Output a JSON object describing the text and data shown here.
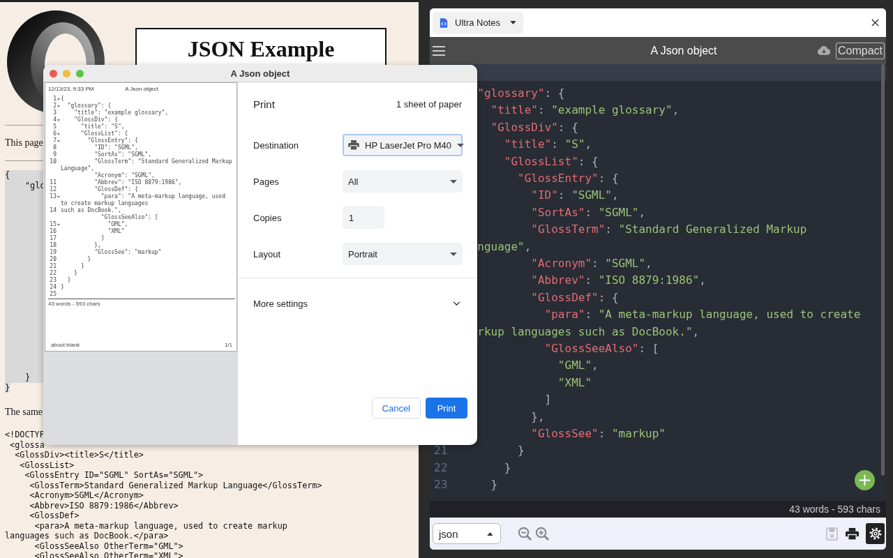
{
  "browser_page": {
    "heading": "JSON Example",
    "intro": "This page",
    "code_top": [
      "{",
      "    \"glo"
    ],
    "code_bottom": [
      "    }",
      "}"
    ],
    "caption": "The same",
    "xml_lines": [
      "<!DOCTYP",
      " <glossa",
      "  <GlossDiv><title>S</title>",
      "   <GlossList>",
      "    <GlossEntry ID=\"SGML\" SortAs=\"SGML\">",
      "     <GlossTerm>Standard Generalized Markup Language</GlossTerm>",
      "     <Acronym>SGML</Acronym>",
      "     <Abbrev>ISO 8879:1986</Abbrev>",
      "     <GlossDef>",
      "      <para>A meta-markup language, used to create markup",
      "languages such as DocBook.</para>",
      "      <GlossSeeAlso OtherTerm=\"GML\">",
      "      <GlossSeeAlso OtherTerm=\"XML\">"
    ]
  },
  "editor": {
    "tab": {
      "label": "Ultra Notes"
    },
    "title": "A Json object",
    "compact_label": "Compact",
    "lines": [
      {
        "current": true
      },
      {
        "current": false,
        "segments": [
          {
            "kind": "key",
            "text": "  \"glossary\""
          },
          {
            "kind": "punct",
            "text": ": {"
          }
        ]
      },
      {
        "current": false,
        "segments": [
          {
            "kind": "key",
            "text": "    \"title\""
          },
          {
            "kind": "punct",
            "text": ": "
          },
          {
            "kind": "string",
            "text": "\"example glossary\""
          },
          {
            "kind": "punct",
            "text": ","
          }
        ]
      },
      {
        "current": false,
        "segments": [
          {
            "kind": "key",
            "text": "    \"GlossDiv\""
          },
          {
            "kind": "punct",
            "text": ": {"
          }
        ]
      },
      {
        "current": false,
        "segments": [
          {
            "kind": "key",
            "text": "      \"title\""
          },
          {
            "kind": "punct",
            "text": ": "
          },
          {
            "kind": "string",
            "text": "\"S\""
          },
          {
            "kind": "punct",
            "text": ","
          }
        ]
      },
      {
        "current": false,
        "segments": [
          {
            "kind": "key",
            "text": "      \"GlossList\""
          },
          {
            "kind": "punct",
            "text": ": {"
          }
        ]
      },
      {
        "current": false,
        "segments": [
          {
            "kind": "key",
            "text": "        \"GlossEntry\""
          },
          {
            "kind": "punct",
            "text": ": {"
          }
        ]
      },
      {
        "current": false,
        "segments": [
          {
            "kind": "key",
            "text": "          \"ID\""
          },
          {
            "kind": "punct",
            "text": ": "
          },
          {
            "kind": "string",
            "text": "\"SGML\""
          },
          {
            "kind": "punct",
            "text": ","
          }
        ]
      },
      {
        "current": false,
        "segments": [
          {
            "kind": "key",
            "text": "          \"SortAs\""
          },
          {
            "kind": "punct",
            "text": ": "
          },
          {
            "kind": "string",
            "text": "\"SGML\""
          },
          {
            "kind": "punct",
            "text": ","
          }
        ]
      },
      {
        "current": false,
        "segments": [
          {
            "kind": "key",
            "text": "          \"GlossTerm\""
          },
          {
            "kind": "punct",
            "text": ": "
          },
          {
            "kind": "string",
            "text": "\"Standard Generalized Markup"
          }
        ]
      },
      {
        "current": false,
        "segments": [
          {
            "kind": "string",
            "text": "  nguage\""
          },
          {
            "kind": "punct",
            "text": ","
          }
        ]
      },
      {
        "current": false,
        "segments": [
          {
            "kind": "key",
            "text": "          \"Acronym\""
          },
          {
            "kind": "punct",
            "text": ": "
          },
          {
            "kind": "string",
            "text": "\"SGML\""
          },
          {
            "kind": "punct",
            "text": ","
          }
        ]
      },
      {
        "current": false,
        "segments": [
          {
            "kind": "key",
            "text": "          \"Abbrev\""
          },
          {
            "kind": "punct",
            "text": ": "
          },
          {
            "kind": "string",
            "text": "\"ISO 8879:1986\""
          },
          {
            "kind": "punct",
            "text": ","
          }
        ]
      },
      {
        "current": false,
        "segments": [
          {
            "kind": "key",
            "text": "          \"GlossDef\""
          },
          {
            "kind": "punct",
            "text": ": {"
          }
        ]
      },
      {
        "current": false,
        "segments": [
          {
            "kind": "key",
            "text": "            \"para\""
          },
          {
            "kind": "punct",
            "text": ": "
          },
          {
            "kind": "string",
            "text": "\"A meta-markup language, used to create"
          }
        ]
      },
      {
        "current": false,
        "segments": [
          {
            "kind": "string",
            "text": "  rkup languages such as DocBook.\""
          },
          {
            "kind": "punct",
            "text": ","
          }
        ]
      },
      {
        "current": false,
        "segments": [
          {
            "kind": "key",
            "text": "            \"GlossSeeAlso\""
          },
          {
            "kind": "punct",
            "text": ": ["
          }
        ]
      },
      {
        "current": false,
        "segments": [
          {
            "kind": "string",
            "text": "              \"GML\""
          },
          {
            "kind": "punct",
            "text": ","
          }
        ]
      },
      {
        "current": false,
        "segments": [
          {
            "kind": "string",
            "text": "              \"XML\""
          }
        ]
      },
      {
        "current": false,
        "segments": [
          {
            "kind": "punct",
            "text": "            ]"
          }
        ]
      },
      {
        "current": false,
        "segments": [
          {
            "kind": "punct",
            "text": "          },"
          }
        ]
      },
      {
        "current": false,
        "segments": [
          {
            "kind": "key",
            "text": "          \"GlossSee\""
          },
          {
            "kind": "punct",
            "text": ": "
          },
          {
            "kind": "string",
            "text": "\"markup\""
          }
        ]
      },
      {
        "number": "21",
        "current": false,
        "segments": [
          {
            "kind": "punct",
            "text": "        }"
          }
        ]
      },
      {
        "number": "22",
        "current": false,
        "segments": [
          {
            "kind": "punct",
            "text": "      }"
          }
        ]
      },
      {
        "number": "23",
        "current": false,
        "segments": [
          {
            "kind": "punct",
            "text": "    }"
          }
        ]
      }
    ],
    "status": "43 words - 593 chars",
    "language": "json",
    "save_disabled": true
  },
  "print_dialog": {
    "title": "A Json object",
    "heading": "Print",
    "sheets": "1 sheet of paper",
    "preview": {
      "date": "12/13/23, 9:33 PM",
      "title": "A Json object",
      "lines": [
        {
          "number": "1",
          "fold": true,
          "text": "{"
        },
        {
          "number": "2",
          "fold": true,
          "text": "  \"glossary\": {"
        },
        {
          "number": "3",
          "fold": false,
          "text": "    \"title\": \"example glossary\","
        },
        {
          "number": "4",
          "fold": true,
          "text": "    \"GlossDiv\": {"
        },
        {
          "number": "5",
          "fold": false,
          "text": "      \"title\": \"S\","
        },
        {
          "number": "6",
          "fold": true,
          "text": "      \"GlossList\": {"
        },
        {
          "number": "7",
          "fold": true,
          "text": "        \"GlossEntry\": {"
        },
        {
          "number": "8",
          "fold": false,
          "text": "          \"ID\": \"SGML\","
        },
        {
          "number": "9",
          "fold": false,
          "text": "          \"SortAs\": \"SGML\","
        },
        {
          "number": "10",
          "fold": false,
          "text": "          \"GlossTerm\": \"Standard Generalized Markup Language\","
        },
        {
          "fold": false,
          "text": "          \"Acronym\": \"SGML\","
        },
        {
          "number": "11",
          "fold": false,
          "text": "          \"Abbrev\": \"ISO 8879:1986\","
        },
        {
          "number": "12",
          "fold": false,
          "text": "          \"GlossDef\": {"
        },
        {
          "number": "13",
          "fold": true,
          "text": "            \"para\": \"A meta-markup language, used to create markup languages"
        },
        {
          "number": "14",
          "fold": false,
          "text": "such as DocBook.\","
        },
        {
          "fold": false,
          "text": "            \"GlossSeeAlso\": ["
        },
        {
          "number": "15",
          "fold": true,
          "text": "              \"GML\","
        },
        {
          "number": "16",
          "fold": false,
          "text": "              \"XML\""
        },
        {
          "number": "17",
          "fold": false,
          "text": "            ]"
        },
        {
          "number": "18",
          "fold": false,
          "text": "          },"
        },
        {
          "number": "19",
          "fold": false,
          "text": "          \"GlossSee\": \"markup\""
        },
        {
          "number": "20",
          "fold": false,
          "text": "        }"
        },
        {
          "number": "21",
          "fold": false,
          "text": "      }"
        },
        {
          "number": "22",
          "fold": false,
          "text": "    }"
        },
        {
          "number": "23",
          "fold": false,
          "text": "  }"
        },
        {
          "number": "24",
          "fold": false,
          "text": "}"
        },
        {
          "number": "25",
          "fold": false
        }
      ],
      "count": "43 words - 593 chars",
      "footer_left": "about:blank",
      "footer_right": "1/1"
    },
    "settings": [
      {
        "kind": "printer",
        "label": "Destination",
        "value": "HP LaserJet Pro M40",
        "focused": true
      },
      {
        "kind": "select",
        "label": "Pages",
        "value": "All",
        "focused": false
      },
      {
        "kind": "number",
        "label": "Copies",
        "value": "1",
        "focused": false
      },
      {
        "kind": "select",
        "label": "Layout",
        "value": "Portrait",
        "focused": false
      }
    ],
    "more_settings": {
      "label": "More settings"
    },
    "buttons": [
      {
        "kind": "secondary",
        "label": "Cancel"
      },
      {
        "kind": "primary",
        "label": "Print"
      }
    ]
  }
}
